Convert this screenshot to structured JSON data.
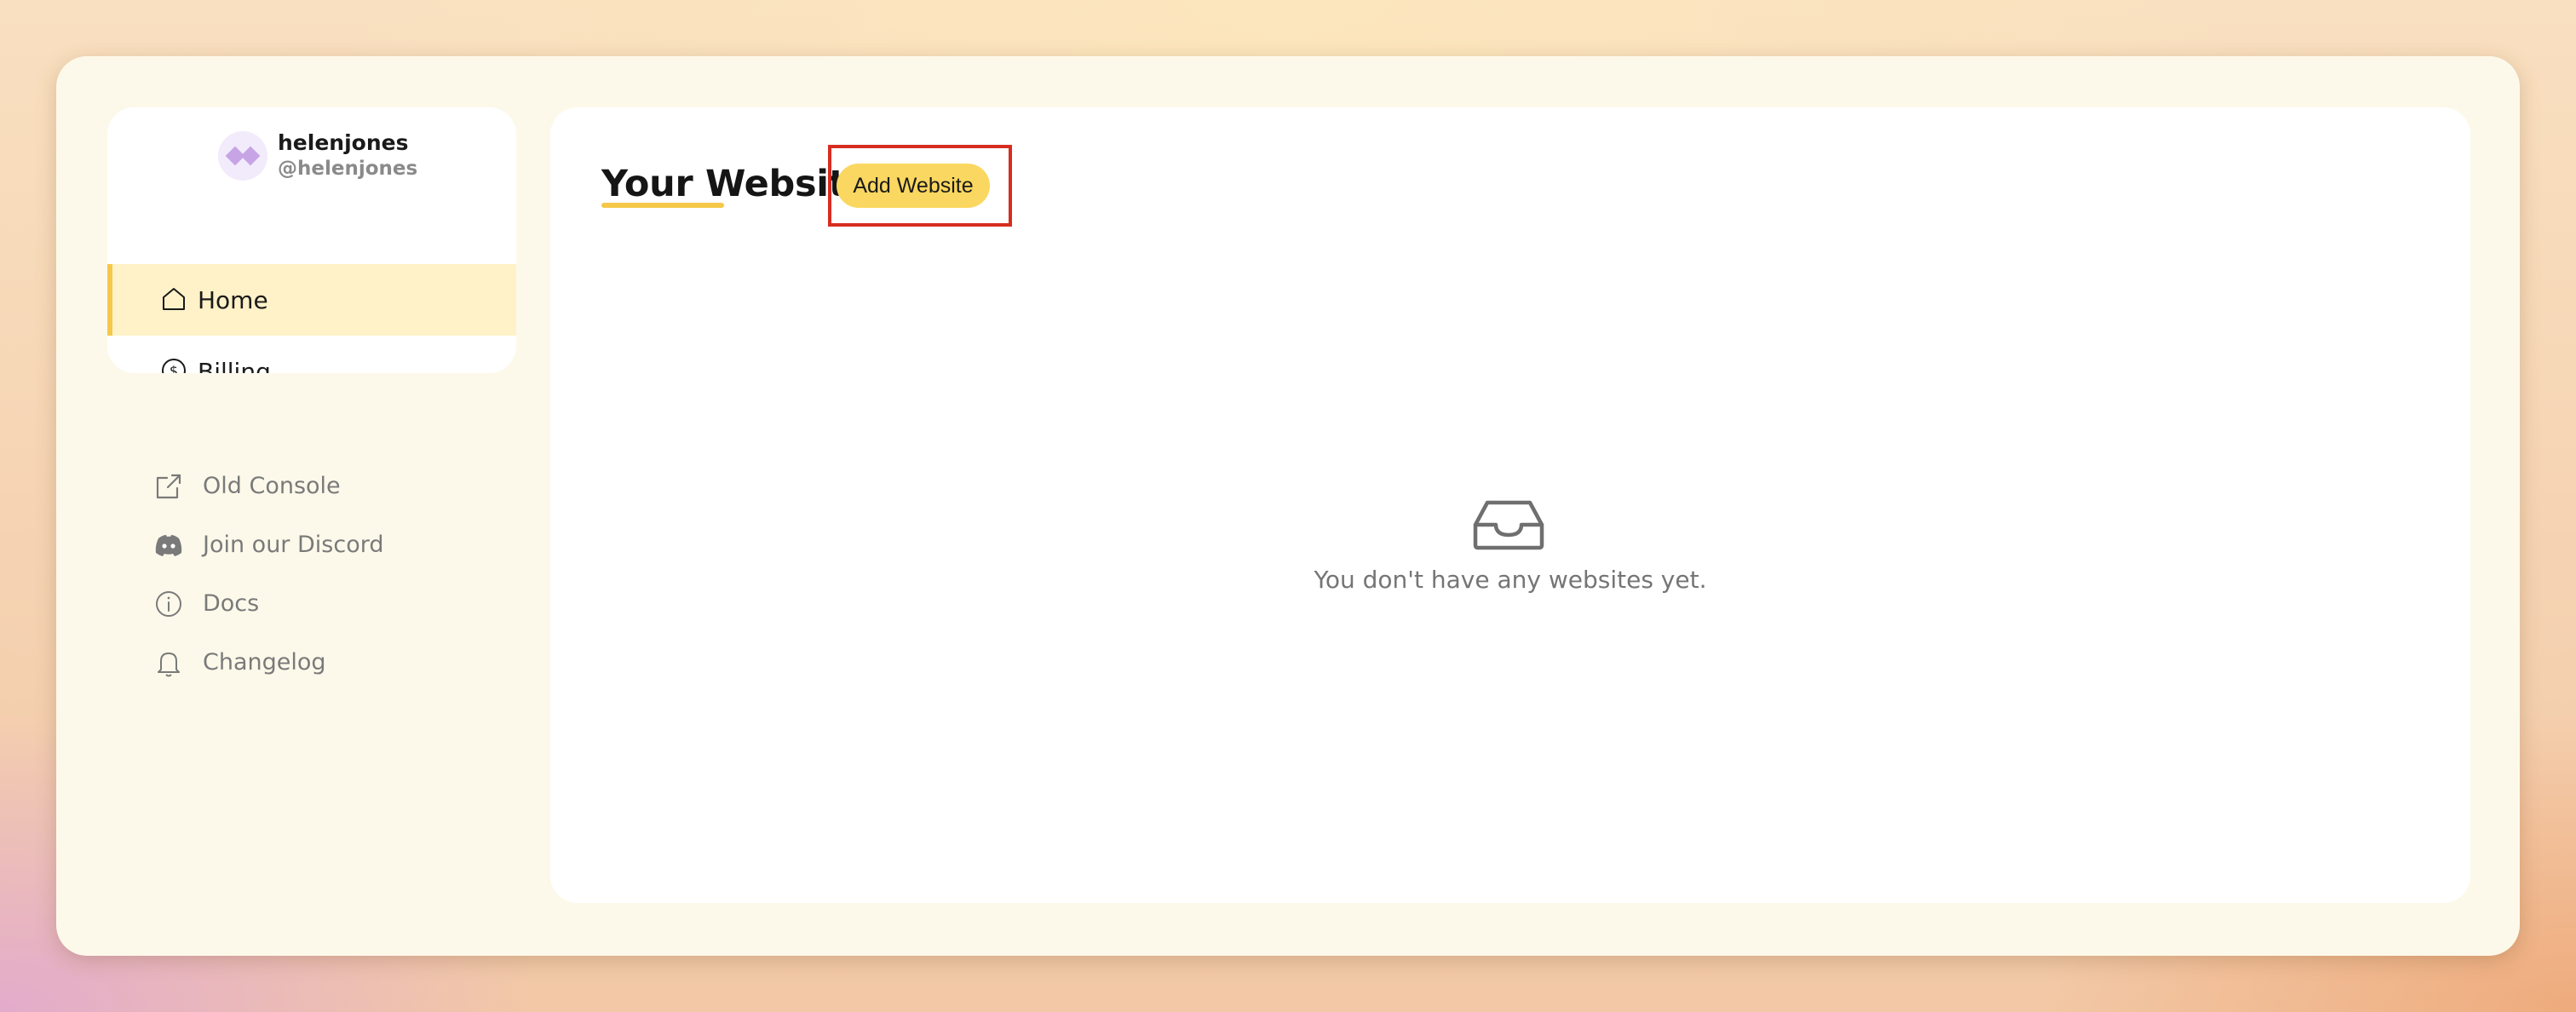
{
  "user": {
    "username": "helenjones",
    "handle": "@helenjones"
  },
  "nav": {
    "home_label": "Home",
    "billing_label": "Billing"
  },
  "links": {
    "old_console": "Old Console",
    "discord": "Join our Discord",
    "docs": "Docs",
    "changelog": "Changelog"
  },
  "main": {
    "title": "Your Websites",
    "add_button_label": "Add Website",
    "empty_message": "You don't have any websites yet."
  },
  "colors": {
    "accent": "#f5c84a",
    "button": "#fad760",
    "active_nav_bg": "#fff2c8",
    "highlight_frame": "#d62d20"
  },
  "icons": {
    "home": "home-icon",
    "billing": "dollar-coin-icon",
    "old_console": "external-link-icon",
    "discord": "discord-icon",
    "docs": "info-icon",
    "changelog": "bell-icon",
    "empty": "inbox-icon"
  }
}
